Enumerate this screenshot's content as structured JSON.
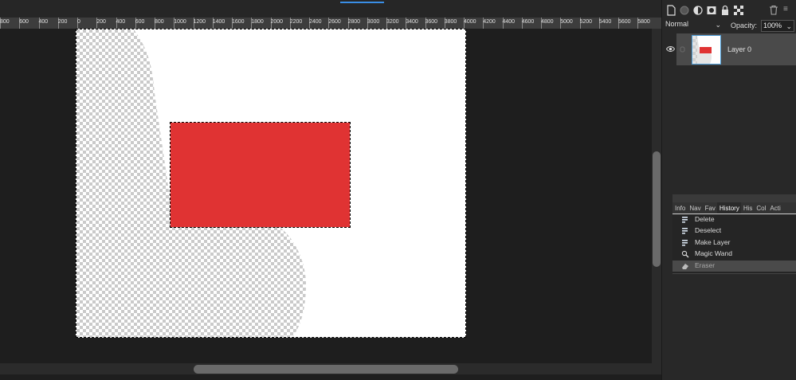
{
  "ruler": {
    "labels": [
      "800",
      "600",
      "400",
      "200",
      "0",
      "200",
      "400",
      "600",
      "800",
      "1000",
      "1200",
      "1400",
      "1600",
      "1800",
      "2000",
      "2200",
      "2400",
      "2600",
      "2800",
      "3000",
      "3200",
      "3400",
      "3600",
      "3800",
      "4000",
      "4200",
      "4400",
      "4600",
      "4800",
      "5000",
      "5200",
      "5400",
      "5600",
      "5800"
    ]
  },
  "canvas": {
    "document_color": "#ffffff",
    "rectangle_color": "#e03333"
  },
  "layers_panel": {
    "blend_mode": "Normal",
    "opacity_label": "Opacity:",
    "opacity_value": "100%",
    "layer_name": "Layer 0"
  },
  "history_panel": {
    "tabs": [
      {
        "label": "Info",
        "active": false
      },
      {
        "label": "Nav",
        "active": false
      },
      {
        "label": "Fav",
        "active": false
      },
      {
        "label": "History",
        "active": true
      },
      {
        "label": "His",
        "active": false
      },
      {
        "label": "Col",
        "active": false
      },
      {
        "label": "Acti",
        "active": false
      }
    ],
    "items": [
      {
        "label": "Delete",
        "icon": "history-step-icon",
        "selected": false
      },
      {
        "label": "Deselect",
        "icon": "history-step-icon",
        "selected": false
      },
      {
        "label": "Make Layer",
        "icon": "history-step-icon",
        "selected": false
      },
      {
        "label": "Magic Wand",
        "icon": "magic-wand-icon",
        "selected": false
      },
      {
        "label": "Eraser",
        "icon": "eraser-icon",
        "selected": true
      }
    ]
  },
  "colors": {
    "accent": "#3a8ee6",
    "workspace": "#1e1e1e",
    "panel": "#282828"
  }
}
